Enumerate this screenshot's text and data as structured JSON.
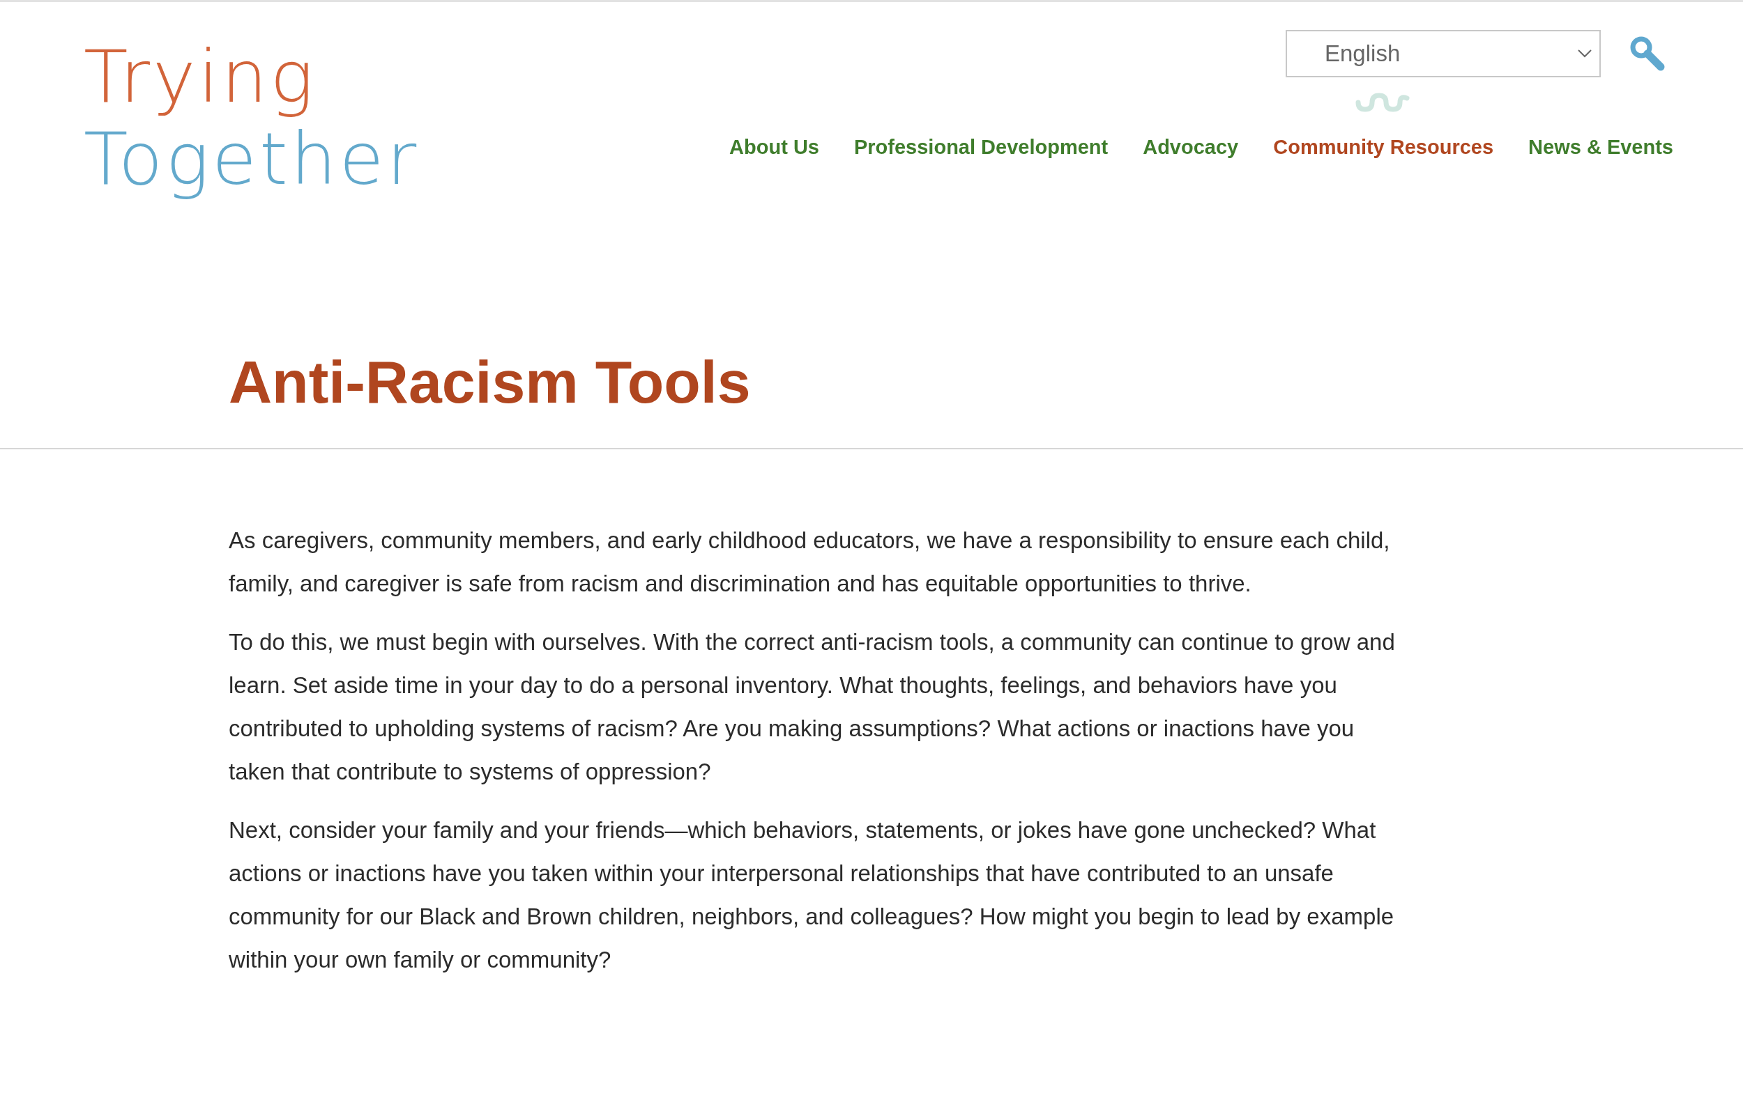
{
  "logo": {
    "line_1": "Trying",
    "line_2": "Together"
  },
  "language_select": {
    "value": "English"
  },
  "nav": [
    {
      "label": "About Us",
      "selected": false
    },
    {
      "label": "Professional Development",
      "selected": false
    },
    {
      "label": "Advocacy",
      "selected": false
    },
    {
      "label": "Community Resources",
      "selected": true
    },
    {
      "label": "News & Events",
      "selected": false
    }
  ],
  "page_title": "Anti-Racism Tools",
  "paragraphs": [
    "As caregivers, community members, and early childhood educators, we have a responsibility to ensure each child, family, and caregiver is safe from racism and discrimination and has equitable opportunities to thrive.",
    "To do this, we must begin with ourselves. With the correct anti-racism tools, a community can continue to grow and learn. Set aside time in your day to do a personal inventory. What thoughts, feelings, and behaviors have you contributed to upholding systems of racism? Are you making assumptions? What actions or inactions have you taken that contribute to systems of oppression?",
    "Next, consider your family and your friends—which behaviors, statements, or jokes have gone unchecked? What actions or inactions have you taken within your interpersonal relationships that have contributed to an unsafe community for our Black and Brown children, neighbors, and colleagues? How might you begin to lead by example within your own family or community?"
  ]
}
